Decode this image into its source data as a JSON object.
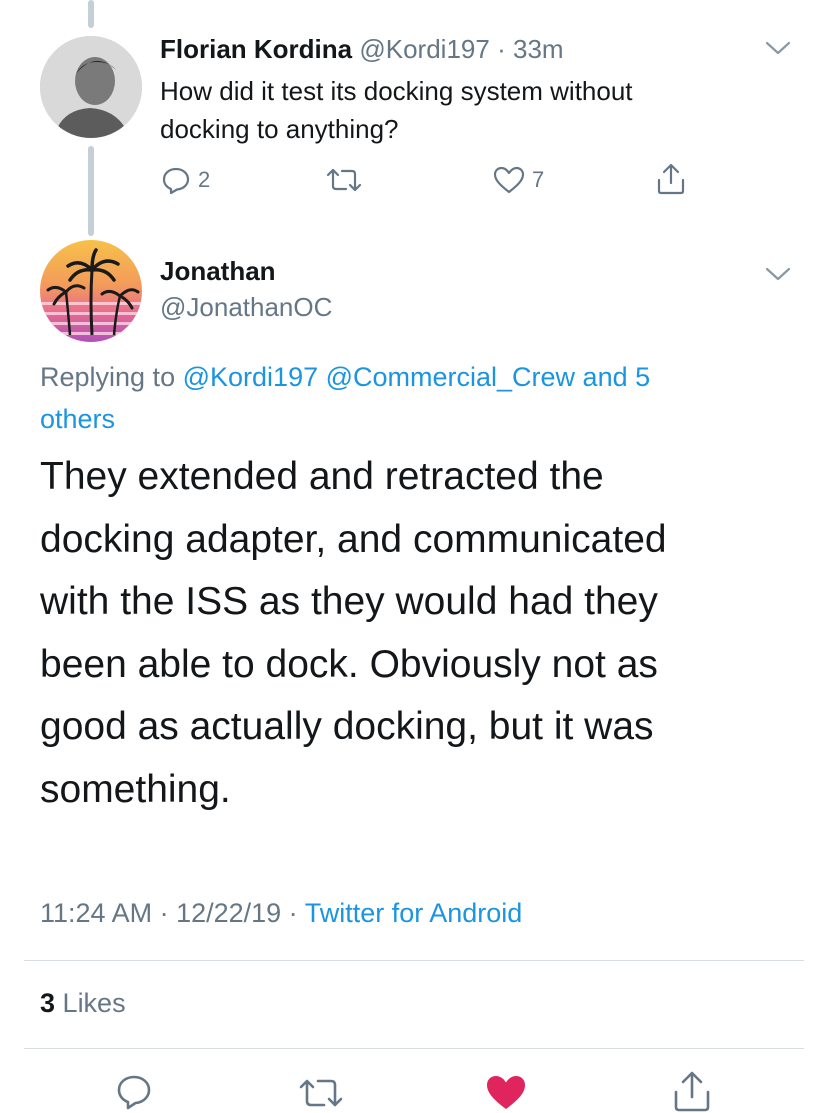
{
  "parent_tweet": {
    "author_name": "Florian Kordina",
    "handle": "@Kordi197",
    "separator": "·",
    "time": "33m",
    "text_line1": "How did it test its docking system without",
    "text_line2": "docking to anything?",
    "reply_count": "2",
    "like_count": "7",
    "icons": [
      "reply-icon",
      "retweet-icon",
      "like-icon",
      "share-icon",
      "chevron-down-icon"
    ]
  },
  "main_tweet": {
    "author_name": "Jonathan",
    "handle": "@JonathanOC",
    "replying_prefix": "Replying to",
    "replying_users": "@Kordi197 @Commercial_Crew and 5",
    "replying_others": "others",
    "text_lines": [
      "They extended and retracted the",
      "docking adapter, and communicated",
      "with the ISS as they would had they",
      "been able to dock.  Obviously not as",
      "good as actually docking, but it was",
      "something."
    ],
    "timestamp": "11:24 AM · 12/22/19 ·",
    "source": "Twitter for Android",
    "likes_count": "3",
    "likes_label": "Likes",
    "colors": {
      "link": "#1b95e0",
      "like_active": "#e0245e",
      "muted": "#657786"
    }
  }
}
